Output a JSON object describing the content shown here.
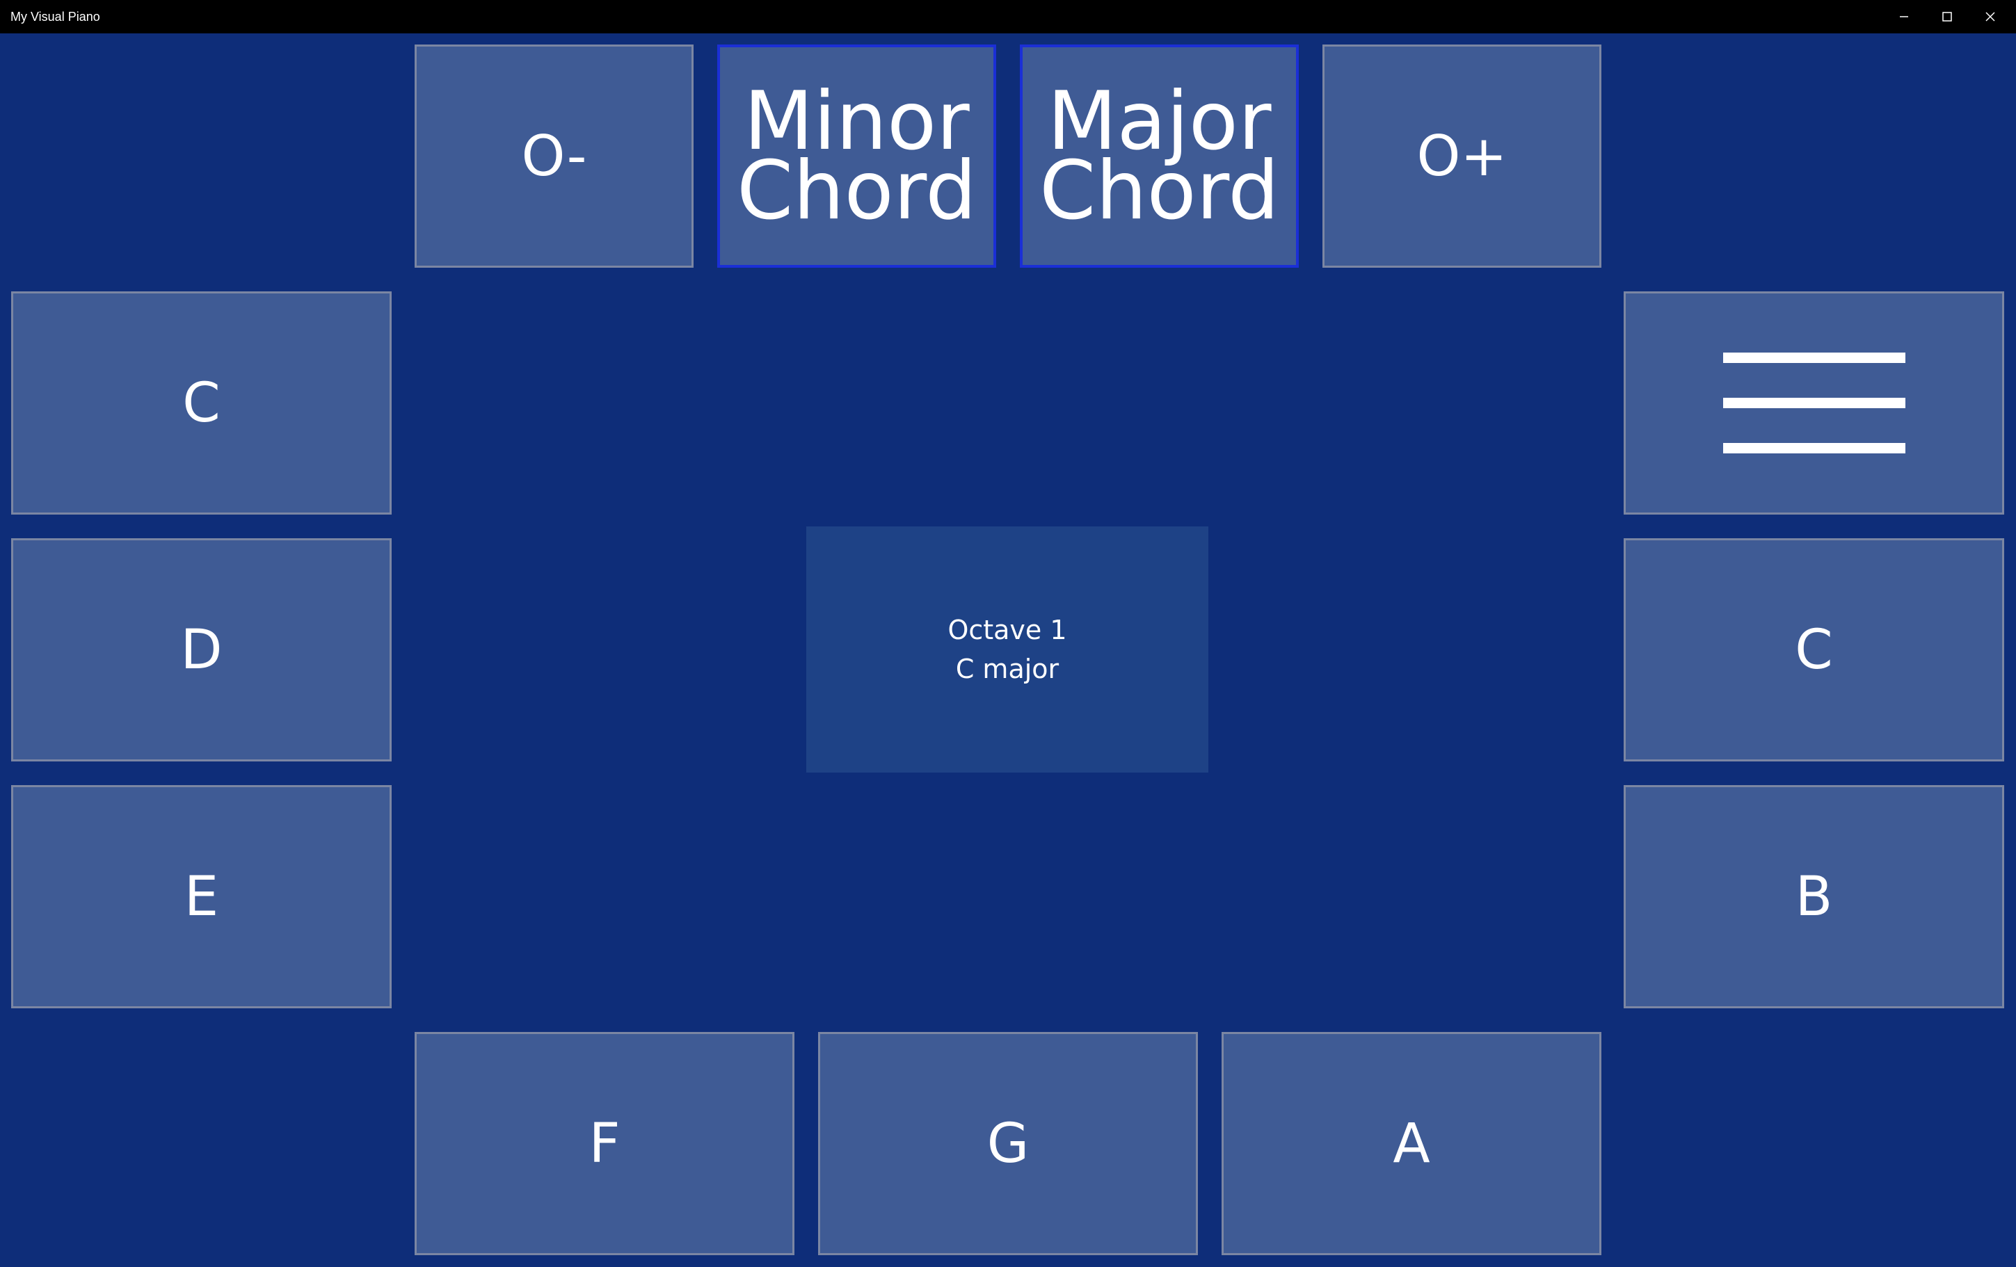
{
  "window": {
    "title": "My Visual Piano",
    "controls": {
      "minimize_icon": "minimize-icon",
      "maximize_icon": "maximize-icon",
      "close_icon": "close-icon"
    }
  },
  "colors": {
    "background": "#0e2d79",
    "tile": "#3f5b95",
    "tile_border": "#7b86a3",
    "chord_border": "#1b2fd6",
    "status_panel": "#1e4286",
    "titlebar": "#000000",
    "text": "#ffffff"
  },
  "top_row": {
    "octave_down": "O-",
    "minor_chord": {
      "line1": "Minor",
      "line2": "Chord"
    },
    "major_chord": {
      "line1": "Major",
      "line2": "Chord"
    },
    "octave_up": "O+"
  },
  "left_keys": [
    "C",
    "D",
    "E"
  ],
  "right_keys": {
    "menu_icon": "hamburger-menu-icon",
    "items": [
      "C",
      "B"
    ]
  },
  "bottom_keys": [
    "F",
    "G",
    "A"
  ],
  "status": {
    "octave": "Octave 1",
    "key": "C major"
  }
}
